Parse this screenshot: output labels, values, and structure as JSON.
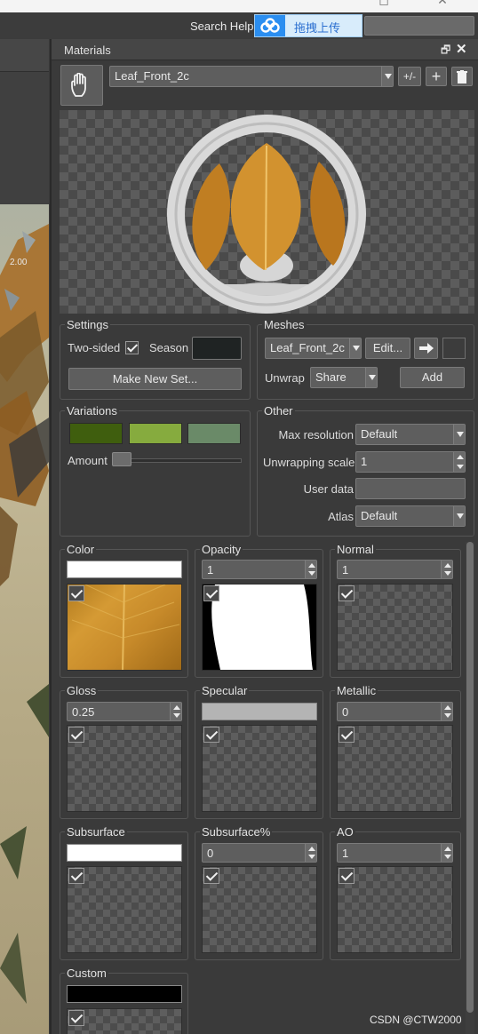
{
  "topbar": {
    "search_help": "Search Help",
    "upload_label": "拖拽上传"
  },
  "panel": {
    "title": "Materials",
    "dock_icon": "restore-icon",
    "close_icon": "close-icon"
  },
  "material": {
    "selected": "Leaf_Front_2c",
    "plusminus_label": "+/-",
    "add_icon": "plus-icon",
    "delete_icon": "trash-icon"
  },
  "settings": {
    "title": "Settings",
    "two_sided_label": "Two-sided",
    "two_sided_checked": true,
    "season_label": "Season",
    "make_new_set_label": "Make New Set..."
  },
  "meshes": {
    "title": "Meshes",
    "mesh_selected": "Leaf_Front_2c",
    "edit_label": "Edit...",
    "unwrap_label": "Unwrap",
    "unwrap_value": "Share",
    "add_label": "Add"
  },
  "variations": {
    "title": "Variations",
    "swatch_colors": [
      "#3f5e0e",
      "#86ab3e",
      "#6a8a68"
    ],
    "amount_label": "Amount"
  },
  "other": {
    "title": "Other",
    "max_resolution_label": "Max resolution",
    "max_resolution_value": "Default",
    "unwrapping_scale_label": "Unwrapping scale",
    "unwrapping_scale_value": "1",
    "user_data_label": "User data",
    "user_data_value": "",
    "atlas_label": "Atlas",
    "atlas_value": "Default"
  },
  "channels": {
    "color": {
      "label": "Color",
      "swatch": "#ffffff"
    },
    "opacity": {
      "label": "Opacity",
      "value": "1"
    },
    "normal": {
      "label": "Normal",
      "value": "1"
    },
    "gloss": {
      "label": "Gloss",
      "value": "0.25"
    },
    "specular": {
      "label": "Specular",
      "swatch": "#b4b4b4"
    },
    "metallic": {
      "label": "Metallic",
      "value": "0"
    },
    "subsurface": {
      "label": "Subsurface",
      "swatch": "#ffffff"
    },
    "subsurface_pct": {
      "label": "Subsurface%",
      "value": "0"
    },
    "ao": {
      "label": "AO",
      "value": "1"
    },
    "custom": {
      "label": "Custom",
      "swatch": "#000000"
    }
  },
  "viewport": {
    "overlay_value": "2.00"
  },
  "watermark": "CSDN @CTW2000"
}
